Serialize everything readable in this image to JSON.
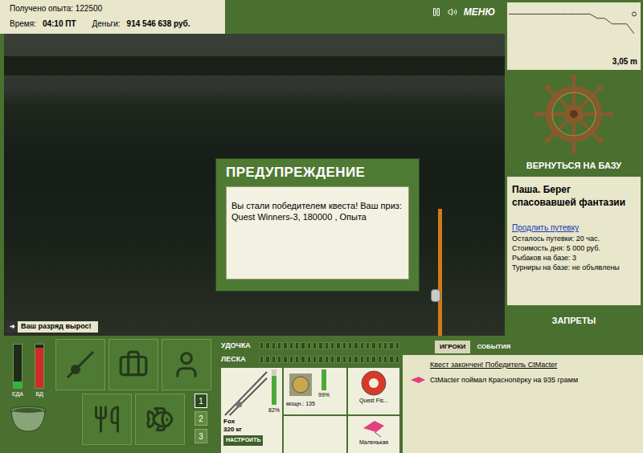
{
  "hud": {
    "experience": "Получено опыта: 122500",
    "time_label": "Время:",
    "time": "04:10 ПТ",
    "money_label": "Деньги:",
    "money": "914 546 638 руб."
  },
  "toolbar": {
    "menu": "МЕНЮ"
  },
  "depth_chart": {
    "values": [
      0.6,
      0.6,
      0.6,
      0.6,
      0.6,
      0.6,
      0.6,
      0.6,
      0.6,
      0.6,
      0.6,
      0.6,
      0.9,
      0.9,
      1.3,
      1.3,
      1.3,
      2.0
    ],
    "max": 4,
    "reading": "3,05 m"
  },
  "dialog": {
    "title": "ПРЕДУПРЕЖДЕНИЕ",
    "message": "Вы стали победителем квеста! Ваш приз: Quest Winners-3, 180000 , Опыта"
  },
  "notification": "Ваш разряд вырос!",
  "base": {
    "button": "ВЕРНУТЬСЯ НА БАЗУ",
    "name": "Паша. Берег спасовавшей фантазии",
    "link": "Продлить путевку",
    "details": [
      "Осталось путевки: 20 час.",
      "Стоимость дня: 5 000 руб.",
      "Рыбаков на базе: 3",
      "Турниры на базе: не объявлены"
    ],
    "bans": "ЗАПРЕТЫ"
  },
  "meters": [
    {
      "label": "ЕДА",
      "level": 0.15,
      "color": "#2fb34a"
    },
    {
      "label": "ВД",
      "level": 0.92,
      "color": "#d02a2a"
    }
  ],
  "slots": [
    {
      "label": "1",
      "selected": true
    },
    {
      "label": "2",
      "selected": false
    },
    {
      "label": "3",
      "selected": false
    }
  ],
  "gear": {
    "tension": [
      {
        "label": "УДОЧКА",
        "level": 0
      },
      {
        "label": "ЛЕСКА",
        "level": 0
      }
    ],
    "rod": {
      "name": "Fox",
      "detail": "320 кг",
      "wear": "82%",
      "level": 0.82
    },
    "reel": {
      "detail": "мощн.: 135",
      "wear": "99%",
      "level": 0.99
    },
    "line": {
      "name": "Quest Fis..."
    },
    "lure": {
      "name": "Маленькая"
    },
    "configure": "НАСТРОИТЬ"
  },
  "chat": {
    "tabs": [
      {
        "label": "ИГРОКИ",
        "selected": true
      },
      {
        "label": "СОБЫТИЯ",
        "selected": false
      }
    ],
    "messages": [
      {
        "kind": "system",
        "text": "Квест закончен! Победитель CtMacter"
      },
      {
        "kind": "catch",
        "text": "CtMacter поймал Краснопёрку на 935 грамм"
      }
    ]
  }
}
